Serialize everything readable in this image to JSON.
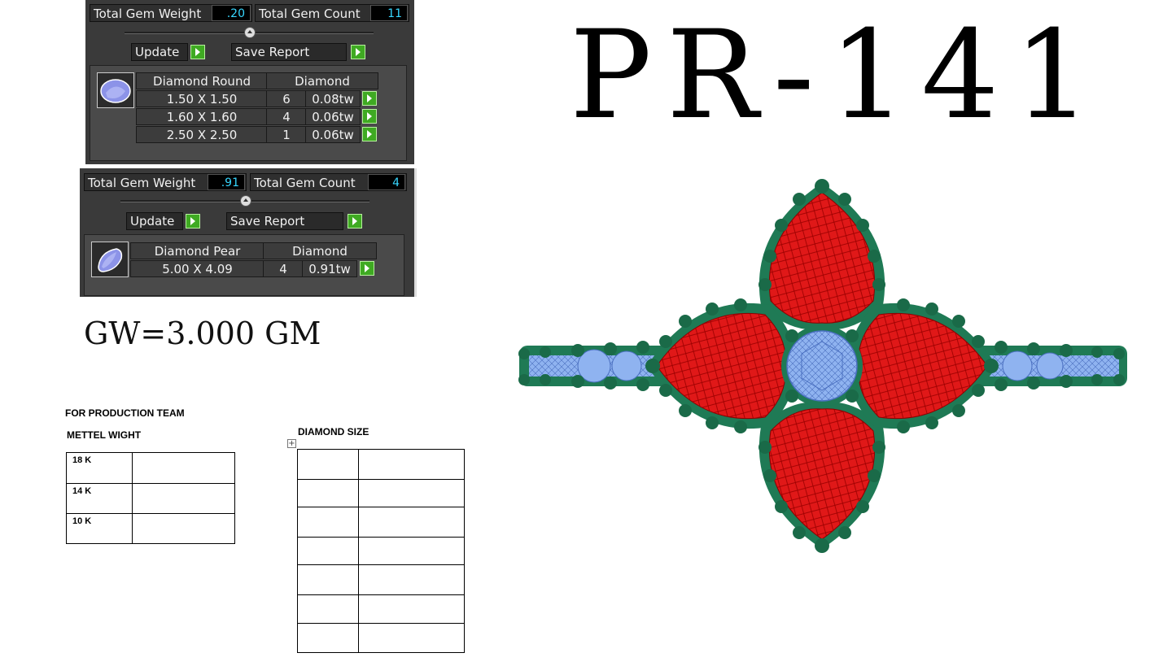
{
  "panel1": {
    "total_gem_weight_label": "Total Gem Weight",
    "total_gem_weight_value": ".20",
    "total_gem_count_label": "Total Gem Count",
    "total_gem_count_value": "11",
    "update_label": "Update",
    "save_report_label": "Save Report",
    "header": [
      "Diamond Round",
      "Diamond"
    ],
    "rows": [
      {
        "size": "1.50 X 1.50",
        "count": "6",
        "weight": "0.08tw"
      },
      {
        "size": "1.60 X 1.60",
        "count": "4",
        "weight": "0.06tw"
      },
      {
        "size": "2.50 X 2.50",
        "count": "1",
        "weight": "0.06tw"
      }
    ]
  },
  "panel2": {
    "total_gem_weight_label": "Total Gem Weight",
    "total_gem_weight_value": ".91",
    "total_gem_count_label": "Total Gem Count",
    "total_gem_count_value": "4",
    "update_label": "Update",
    "save_report_label": "Save Report",
    "header": [
      "Diamond Pear",
      "Diamond"
    ],
    "rows": [
      {
        "size": "5.00 X 4.09",
        "count": "4",
        "weight": "0.91tw"
      }
    ]
  },
  "title": "PR-141",
  "gross_weight": "GW=3.000 GM",
  "production": {
    "heading": "FOR PRODUCTION TEAM",
    "metal_heading": "METTEL WIGHT",
    "metals": [
      "18 K",
      "14 K",
      "10 K"
    ],
    "diamond_heading": "DIAMOND SIZE"
  },
  "colors": {
    "gem_red": "#e01818",
    "metal_green": "#1f7a55",
    "diamond_blue": "#8fb3f0",
    "value_cyan": "#37d7ff",
    "button_green": "#3faa22"
  }
}
